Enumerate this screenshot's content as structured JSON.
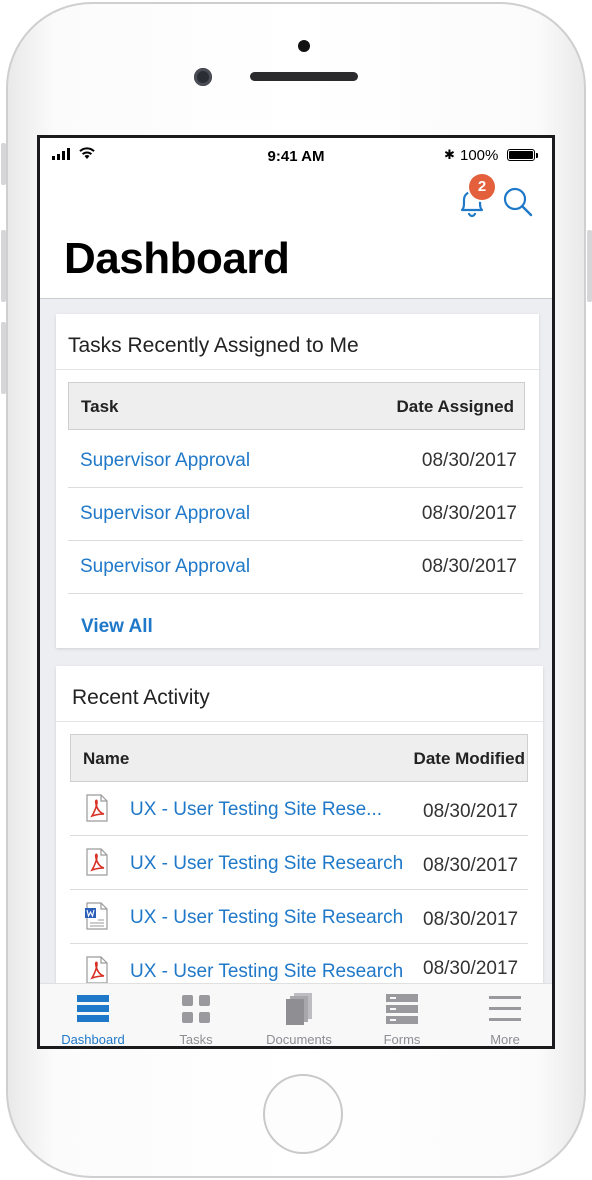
{
  "status_bar": {
    "time": "9:41 AM",
    "battery": "100%",
    "bluetooth": "✱"
  },
  "header": {
    "title": "Dashboard",
    "notification_count": "2"
  },
  "tasks_card": {
    "title": "Tasks Recently Assigned to Me",
    "columns": [
      "Task",
      "Date Assigned"
    ],
    "rows": [
      {
        "task": "Supervisor Approval",
        "date": "08/30/2017"
      },
      {
        "task": "Supervisor Approval",
        "date": "08/30/2017"
      },
      {
        "task": "Supervisor Approval",
        "date": "08/30/2017"
      }
    ],
    "view_all": "View All"
  },
  "activity_card": {
    "title": "Recent Activity",
    "columns": [
      "Name",
      "Date Modified"
    ],
    "rows": [
      {
        "icon": "pdf-file-icon",
        "name": "UX - User Testing Site Rese...",
        "date": "08/30/2017"
      },
      {
        "icon": "pdf-file-icon",
        "name": "UX - User Testing Site Research",
        "date": "08/30/2017"
      },
      {
        "icon": "word-file-icon",
        "name": "UX - User Testing Site Research",
        "date": "08/30/2017"
      },
      {
        "icon": "pdf-file-icon",
        "name": "UX - User Testing Site Research",
        "date": "08/30/2017"
      }
    ]
  },
  "tab_bar": {
    "tabs": [
      {
        "label": "Dashboard",
        "icon": "dashboard-icon",
        "active": true
      },
      {
        "label": "Tasks",
        "icon": "tasks-grid-icon",
        "active": false
      },
      {
        "label": "Documents",
        "icon": "documents-icon",
        "active": false
      },
      {
        "label": "Forms",
        "icon": "forms-icon",
        "active": false
      },
      {
        "label": "More",
        "icon": "more-menu-icon",
        "active": false
      }
    ]
  },
  "colors": {
    "accent": "#1f78c8",
    "badge": "#e4603c",
    "background": "#eceef1"
  }
}
